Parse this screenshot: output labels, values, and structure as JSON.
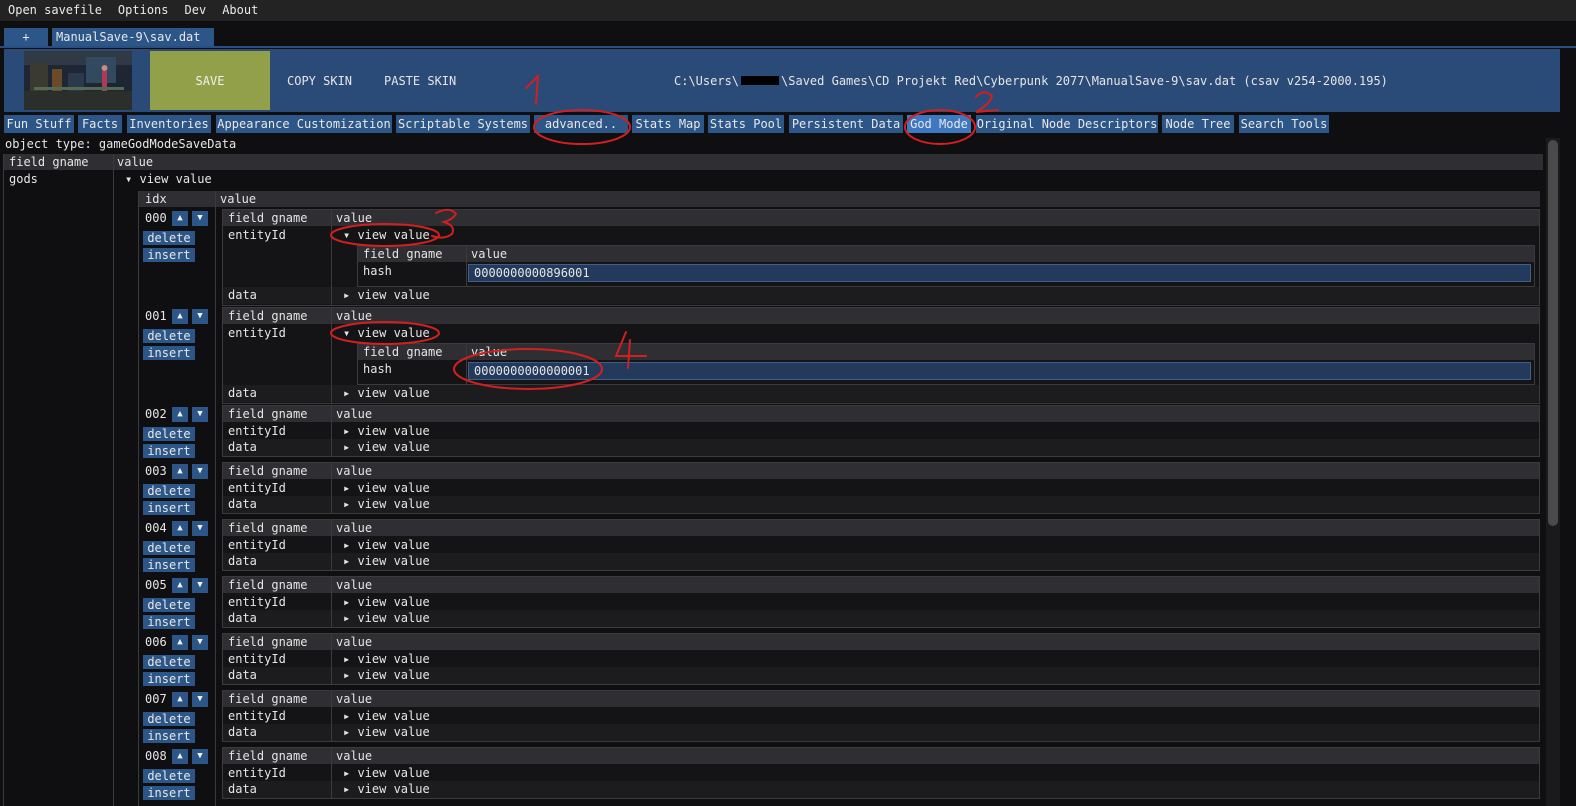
{
  "menu": [
    "Open savefile",
    "Options",
    "Dev",
    "About"
  ],
  "file_tabs": {
    "new_tab": "+",
    "active_file": "ManualSave-9\\sav.dat"
  },
  "header": {
    "save_label": "SAVE",
    "copy_skin_label": "COPY SKIN",
    "paste_skin_label": "PASTE SKIN",
    "path_prefix": "C:\\Users\\",
    "path_suffix": "\\Saved Games\\CD Projekt Red\\Cyberpunk 2077\\ManualSave-9\\sav.dat (csav v254-2000.195)"
  },
  "section_tabs": [
    "Fun Stuff",
    "Facts",
    "Inventories",
    "Appearance Customization",
    "Scriptable Systems",
    "advanced..",
    "Stats Map",
    "Stats Pool",
    "Persistent Data",
    "God Mode",
    "Original Node Descriptors",
    "Node Tree",
    "Search Tools"
  ],
  "active_section": "God Mode",
  "object_type": "object type: gameGodModeSaveData",
  "table": {
    "col_field": "field gname",
    "col_value": "value",
    "field_name": "gods",
    "view_value_label": "view value",
    "col_idx": "idx",
    "entity_field": "entityId",
    "data_field": "data",
    "hash_field": "hash",
    "delete_label": "delete",
    "insert_label": "insert",
    "up_arrow": "▲",
    "down_arrow": "▼",
    "rows": [
      {
        "idx": "000",
        "hash": "0000000000896001"
      },
      {
        "idx": "001",
        "hash": "0000000000000001"
      },
      {
        "idx": "002"
      },
      {
        "idx": "003"
      },
      {
        "idx": "004"
      },
      {
        "idx": "005"
      },
      {
        "idx": "006"
      },
      {
        "idx": "007"
      },
      {
        "idx": "008"
      }
    ]
  },
  "annotations": [
    "1",
    "2",
    "3",
    "4"
  ],
  "colors": {
    "accent": "#2b5687",
    "save": "#93a04a",
    "header": "#2a4b78",
    "annotation": "#d21f1f"
  }
}
